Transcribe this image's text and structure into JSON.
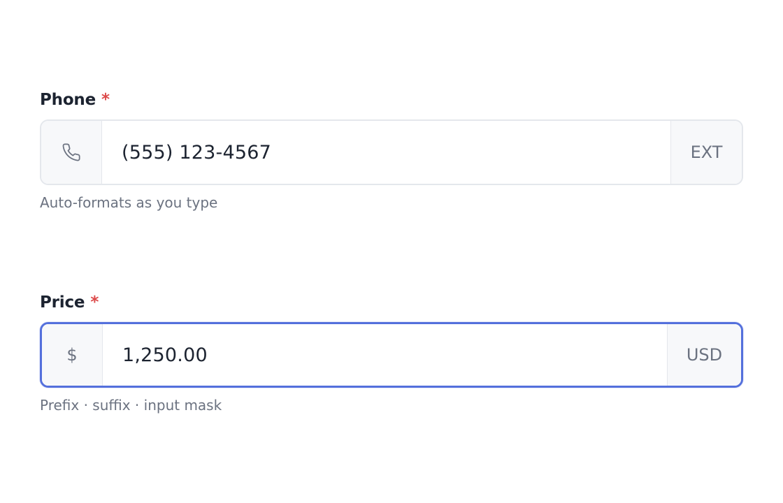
{
  "phone": {
    "label": "Phone",
    "required_mark": "*",
    "prefix_icon": "phone-icon",
    "value": "(555) 123-4567",
    "suffix": "EXT",
    "help": "Auto-formats as you type"
  },
  "price": {
    "label": "Price",
    "required_mark": "*",
    "prefix": "$",
    "value": "1,250.00",
    "suffix": "USD",
    "help": "Prefix · suffix · input mask",
    "focused": true
  },
  "colors": {
    "required": "#dc4a4a",
    "focus_border": "#5470dc",
    "text": "#1c2330",
    "muted": "#6b7280",
    "addon_bg": "#f7f8fa",
    "border": "#e4e7ec"
  }
}
